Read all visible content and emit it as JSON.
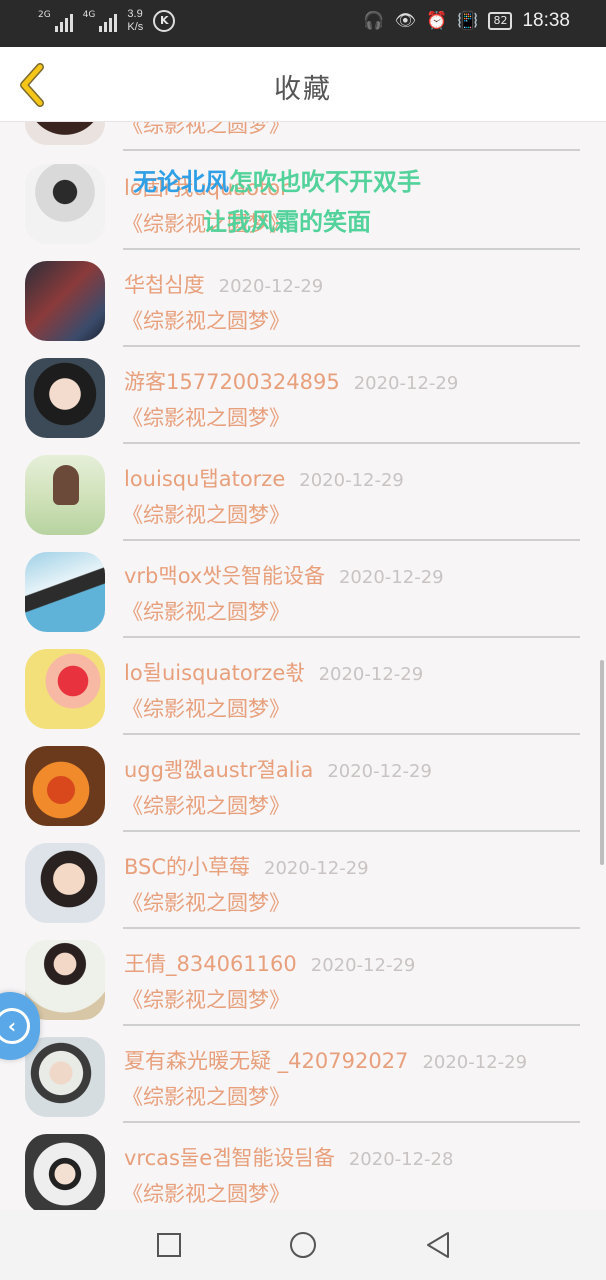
{
  "status_bar": {
    "net1": "2G",
    "net2": "4G",
    "speed_value": "3.9",
    "speed_unit": "K/s",
    "battery": "82",
    "time": "18:38",
    "icons": [
      "headphones-icon",
      "eye-icon",
      "alarm-icon",
      "vibrate-icon"
    ]
  },
  "header": {
    "title": "收藏",
    "back_icon": "chevron-left-icon"
  },
  "lyrics": {
    "line1_highlight": "无论北风",
    "line1_rest": "怎吹也吹不开双手",
    "line2": "让我风霜的笑面"
  },
  "items": [
    {
      "name": "",
      "date": "",
      "subtitle": "《综影视之圆梦》"
    },
    {
      "name": "lo固r我uquaotor",
      "date": "",
      "subtitle": "《综影视之圆梦》"
    },
    {
      "name": "华첩심度",
      "date": "2020-12-29",
      "subtitle": "《综影视之圆梦》"
    },
    {
      "name": "游客1577200324895",
      "date": "2020-12-29",
      "subtitle": "《综影视之圆梦》"
    },
    {
      "name": "louisqu탭atorze",
      "date": "2020-12-29",
      "subtitle": "《综影视之圆梦》"
    },
    {
      "name": "vrb맥ox쌋읏智能设备",
      "date": "2020-12-29",
      "subtitle": "《综影视之圆梦》"
    },
    {
      "name": "lo뒬uisquatorze촧",
      "date": "2020-12-29",
      "subtitle": "《综影视之圆梦》"
    },
    {
      "name": "ugg쾡꼢austr졀alia",
      "date": "2020-12-29",
      "subtitle": "《综影视之圆梦》"
    },
    {
      "name": "BSC的小草莓",
      "date": "2020-12-29",
      "subtitle": "《综影视之圆梦》"
    },
    {
      "name": "王倩_834061160",
      "date": "2020-12-29",
      "subtitle": "《综影视之圆梦》"
    },
    {
      "name": "夏有森光暖无疑 _420792027",
      "date": "2020-12-29",
      "subtitle": "《综影视之圆梦》"
    },
    {
      "name": "vrcas둘e곕智能设딈备",
      "date": "2020-12-28",
      "subtitle": "《综影视之圆梦》"
    }
  ],
  "colors": {
    "accent": "#e8a07c",
    "date": "#c9c3c3",
    "highlight": "#2f9fe6",
    "lyric": "#53d29b"
  }
}
